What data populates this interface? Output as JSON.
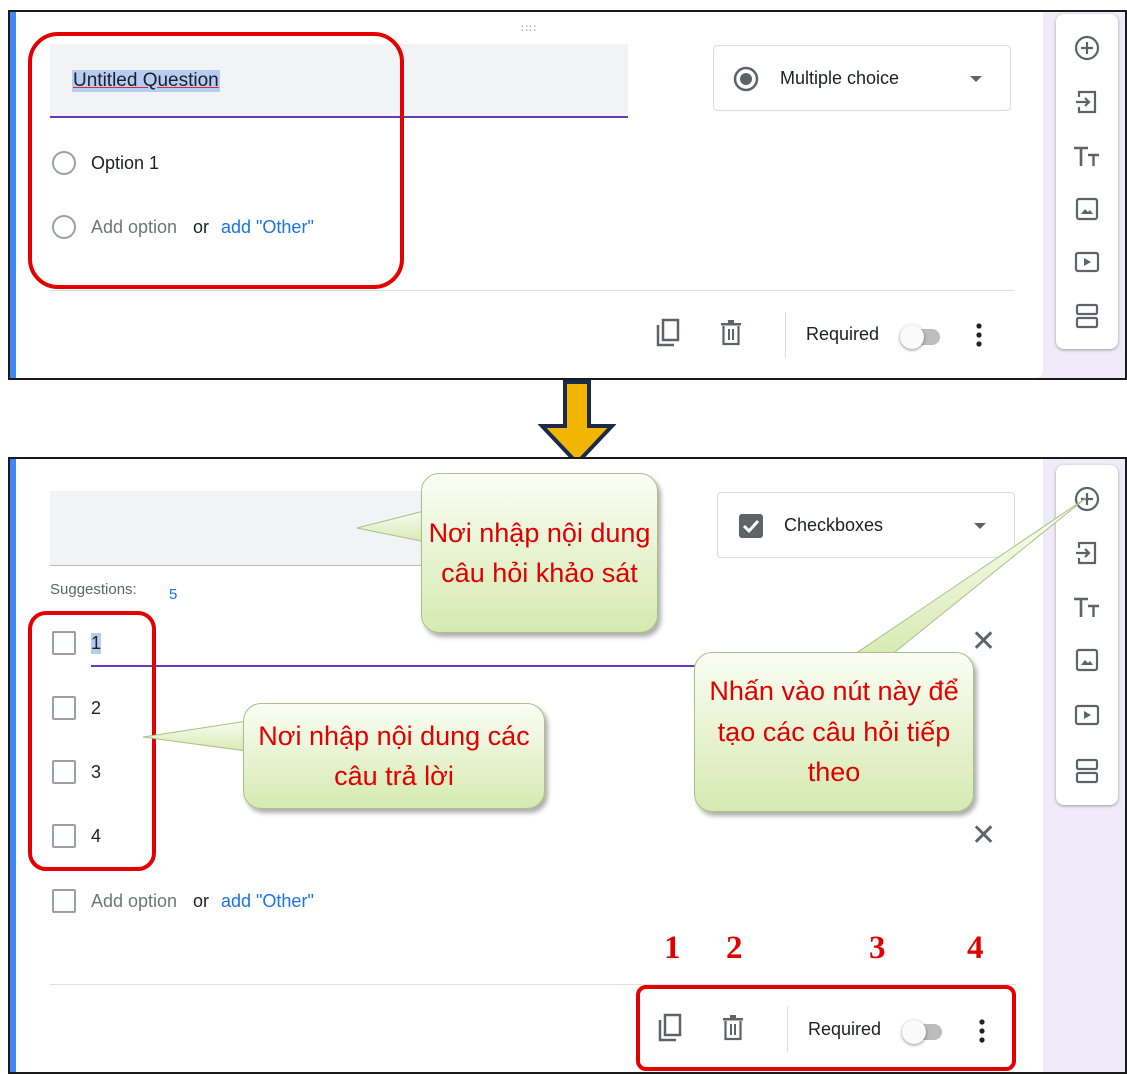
{
  "panel1": {
    "drag_handle": "∷∷",
    "question_title": "Untitled Question",
    "question_type": "Multiple choice",
    "options": [
      "Option 1"
    ],
    "add_option": "Add option",
    "or": "or",
    "add_other": "add \"Other\"",
    "required_label": "Required"
  },
  "panel2": {
    "question_type": "Checkboxes",
    "suggestions_label": "Suggestions:",
    "suggestion_value": "5",
    "options": [
      "1",
      "2",
      "3",
      "4"
    ],
    "add_option": "Add option",
    "or": "or",
    "add_other": "add \"Other\"",
    "required_label": "Required",
    "callouts": {
      "question_area": "Nơi nhập nội dung câu hỏi khảo sát",
      "answer_area": "Nơi nhập nội dung các câu trả lời",
      "add_button": "Nhấn vào nút này để tạo các câu hỏi tiếp theo"
    },
    "footer_numbers": [
      "1",
      "2",
      "3",
      "4"
    ]
  },
  "sidebar_icons": [
    "add-question-icon",
    "import-questions-icon",
    "add-title-icon",
    "add-image-icon",
    "add-video-icon",
    "add-section-icon"
  ],
  "colors": {
    "accent_purple": "#673ab7",
    "left_border_blue": "#4285f4",
    "link_blue": "#1a73e8",
    "annotation_red": "#e30000",
    "arrow_fill": "#f2b600",
    "arrow_outline": "#1b2a4a",
    "callout_green_top": "#fbfdf4",
    "callout_green_bottom": "#d5eab0"
  }
}
